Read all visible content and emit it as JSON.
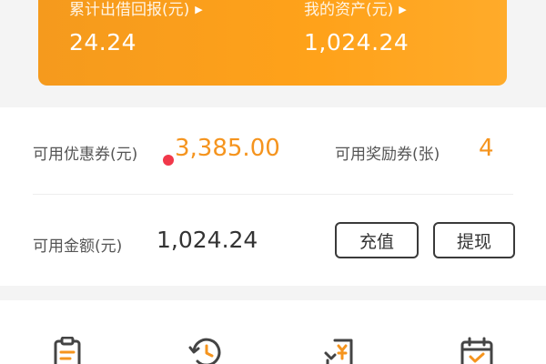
{
  "banner": {
    "earned": {
      "label": "累计出借回报(元)",
      "value": "24.24"
    },
    "assets": {
      "label": "我的资产(元)",
      "value": "1,024.24"
    }
  },
  "summary": {
    "coupon": {
      "label": "可用优惠券(元)",
      "value": "3,385.00"
    },
    "reward": {
      "label": "可用奖励券(张)",
      "value": "4"
    },
    "available": {
      "label": "可用金额(元)",
      "value": "1,024.24"
    }
  },
  "actions": {
    "recharge_label": "充值",
    "withdraw_label": "提现"
  },
  "shortcuts": [
    "clipboard-icon",
    "history-clock-icon",
    "yuan-receipt-icon",
    "calendar-check-icon"
  ],
  "colors": {
    "accent": "#f5941e",
    "banner": "#ffa21a",
    "badge": "#f1384a"
  }
}
